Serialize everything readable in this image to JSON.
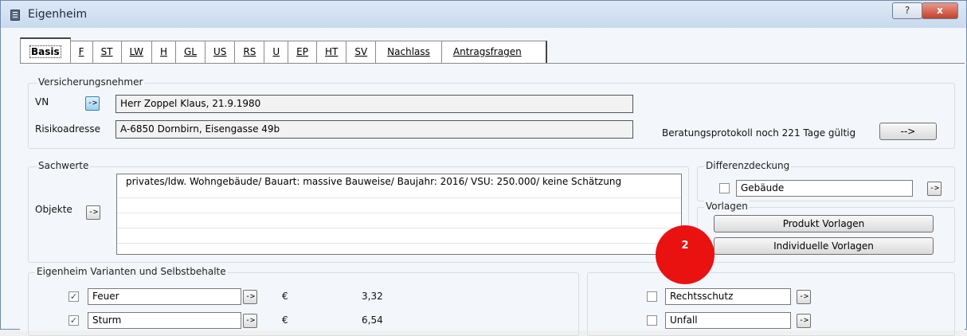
{
  "window": {
    "title": "Eigenheim",
    "help_label": "?",
    "close_label": "x"
  },
  "tabs": [
    {
      "label": "Basis",
      "active": true
    },
    {
      "label": "F"
    },
    {
      "label": "ST"
    },
    {
      "label": "LW"
    },
    {
      "label": "H"
    },
    {
      "label": "GL"
    },
    {
      "label": "US"
    },
    {
      "label": "RS"
    },
    {
      "label": "U"
    },
    {
      "label": "EP"
    },
    {
      "label": "HT"
    },
    {
      "label": "SV"
    },
    {
      "label": "Nachlass"
    },
    {
      "label": "Antragsfragen"
    }
  ],
  "versicherungsnehmer": {
    "legend": "Versicherungsnehmer",
    "vn_label": "VN",
    "vn_button": "->",
    "vn_value": "Herr Zoppel Klaus, 21.9.1980",
    "risk_label": "Risikoadresse",
    "risk_value": "A-6850 Dornbirn, Eisengasse 49b",
    "protocol_text": "Beratungsprotokoll noch 221 Tage gültig",
    "protocol_button": "-->"
  },
  "sachwerte": {
    "legend": "Sachwerte",
    "objects_label": "Objekte",
    "objects_button": "->",
    "objects": [
      "privates/ldw. Wohngebäude/ Bauart: massive Bauweise/ Baujahr: 2016/ VSU: 250.000/ keine Schätzung",
      "",
      "",
      "",
      ""
    ]
  },
  "differenzdeckung": {
    "legend": "Differenzdeckung",
    "checked": false,
    "value": "Gebäude",
    "button": "->"
  },
  "vorlagen": {
    "legend": "Vorlagen",
    "produkt_button": "Produkt Vorlagen",
    "individuelle_button": "Individuelle Vorlagen"
  },
  "annotation_badge": "2",
  "varianten": {
    "legend": "Eigenheim Varianten und Selbstbehalte",
    "currency": "€",
    "left_rows": [
      {
        "label": "Feuer",
        "checked": true,
        "button": "->",
        "currency": "€",
        "amount": "3,32"
      },
      {
        "label": "Sturm",
        "checked": true,
        "button": "->",
        "currency": "€",
        "amount": "6,54"
      }
    ],
    "right_rows": [
      {
        "label": "Rechtsschutz",
        "checked": false,
        "button": "->"
      },
      {
        "label": "Unfall",
        "checked": false,
        "button": "->"
      }
    ]
  },
  "colors": {
    "accent_blue": "#9dd0f2",
    "badge_red": "#ea1111",
    "close_red": "#c4412b"
  }
}
